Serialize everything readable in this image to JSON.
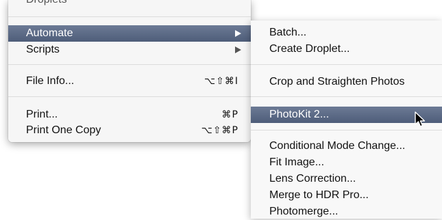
{
  "left_menu": {
    "top_item_partial": "Droplets",
    "items": [
      {
        "label": "Automate",
        "submenu": true,
        "highlighted": true
      },
      {
        "label": "Scripts",
        "submenu": true
      },
      {
        "label": "File Info...",
        "shortcut": "⌥⇧⌘I"
      },
      {
        "label": "Print...",
        "shortcut": "⌘P"
      },
      {
        "label": "Print One Copy",
        "shortcut": "⌥⇧⌘P"
      }
    ]
  },
  "submenu": {
    "items": [
      {
        "label": "Batch..."
      },
      {
        "label": "Create Droplet..."
      },
      {
        "label": "Crop and Straighten Photos"
      },
      {
        "label": "PhotoKit 2...",
        "highlighted": true
      },
      {
        "label": "Conditional Mode Change..."
      },
      {
        "label": "Fit Image..."
      },
      {
        "label": "Lens Correction..."
      },
      {
        "label": "Merge to HDR Pro..."
      },
      {
        "label": "Photomerge..."
      }
    ]
  },
  "icons": {
    "submenu_arrow": "triangle-right",
    "cursor": "arrow-pointer"
  },
  "colors": {
    "highlight_top": "#6c7a95",
    "highlight_bottom": "#4e5d79",
    "menu_bg": "#f6f6f6"
  }
}
